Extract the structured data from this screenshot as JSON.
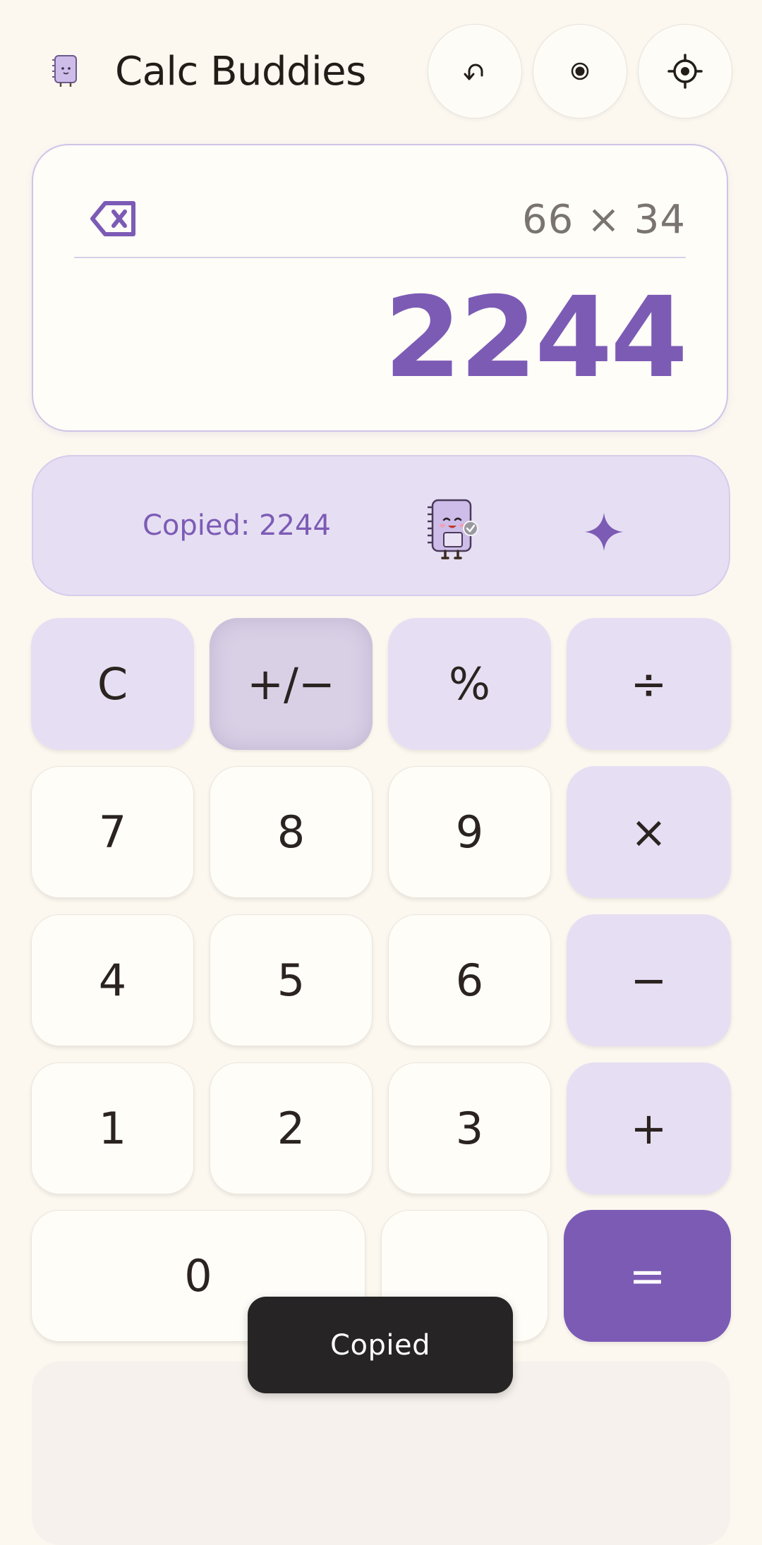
{
  "header": {
    "title": "Calc Buddies",
    "buttons": [
      {
        "icon": "undo-icon"
      },
      {
        "icon": "record-icon"
      },
      {
        "icon": "settings-icon"
      }
    ]
  },
  "display": {
    "expression": "66 × 34",
    "result": "2244",
    "backspace_icon": "backspace-icon"
  },
  "banner": {
    "message": "Copied: 2244",
    "buddy_icon": "notebook-buddy-icon",
    "sparkle_icon": "sparkle-icon"
  },
  "keypad": {
    "row1": [
      "C",
      "+/−",
      "%",
      "÷"
    ],
    "row2": [
      "7",
      "8",
      "9",
      "×"
    ],
    "row3": [
      "4",
      "5",
      "6",
      "−"
    ],
    "row4": [
      "1",
      "2",
      "3",
      "+"
    ],
    "row5": [
      "0",
      ".",
      "="
    ]
  },
  "toast": {
    "text": "Copied"
  },
  "colors": {
    "accent": "#7c5bb5",
    "background": "#fcf8f0",
    "function_key": "#e6dff3",
    "toast": "#262424"
  }
}
